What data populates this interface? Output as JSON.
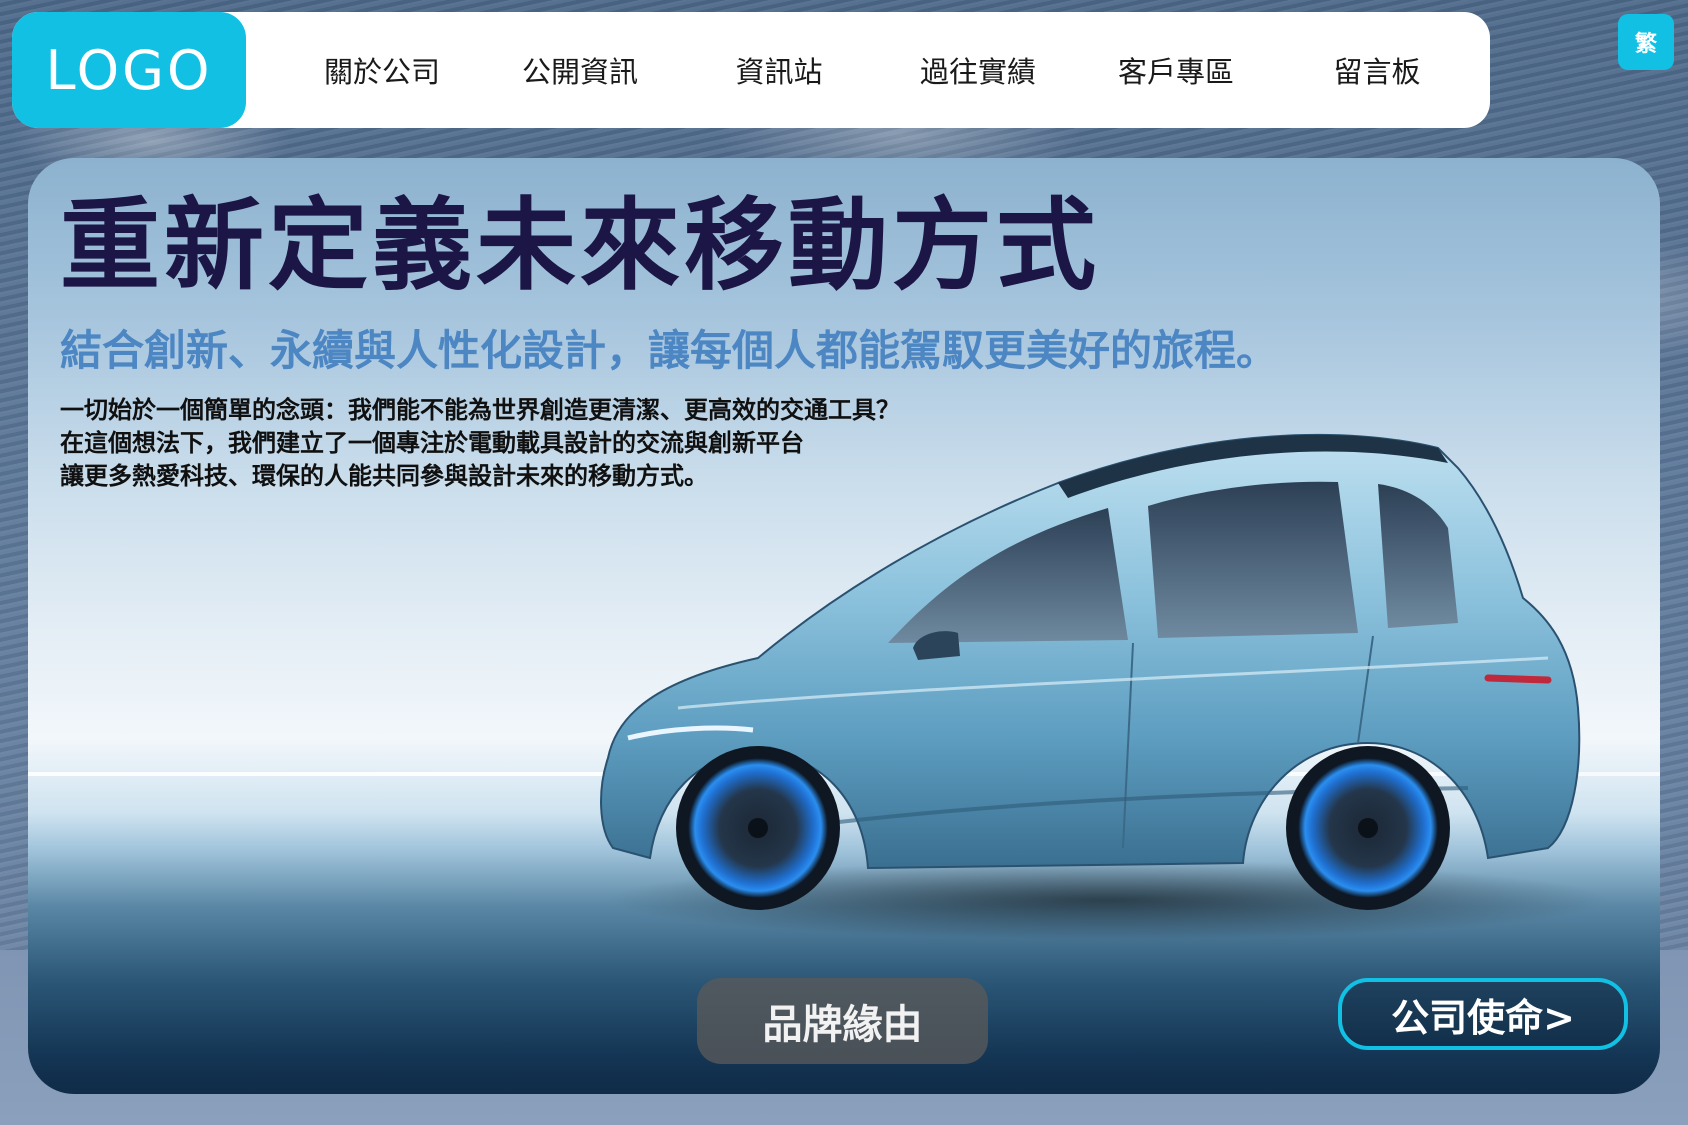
{
  "header": {
    "logo_text": "LOGO",
    "nav": [
      {
        "label": "關於公司"
      },
      {
        "label": "公開資訊"
      },
      {
        "label": "資訊站"
      },
      {
        "label": "過往實績"
      },
      {
        "label": "客戶專區"
      },
      {
        "label": "留言板"
      }
    ],
    "language_label": "繁"
  },
  "hero": {
    "title": "重新定義未來移動方式",
    "subtitle": "結合創新、永續與人性化設計，讓每個人都能駕馭更美好的旅程。",
    "body": [
      "一切始於一個簡單的念頭：我們能不能為世界創造更清潔、更高效的交通工具？",
      "在這個想法下，我們建立了一個專注於電動載具設計的交流與創新平台",
      "讓更多熱愛科技、環保的人能共同參與設計未來的移動方式。"
    ],
    "buttons": {
      "origin": "品牌緣由",
      "mission": "公司使命>"
    }
  },
  "colors": {
    "accent": "#12c0e4",
    "title": "#1b1646",
    "subtitle": "#4c86c3"
  },
  "icons": {
    "car_image": "electric-car-illustration"
  }
}
